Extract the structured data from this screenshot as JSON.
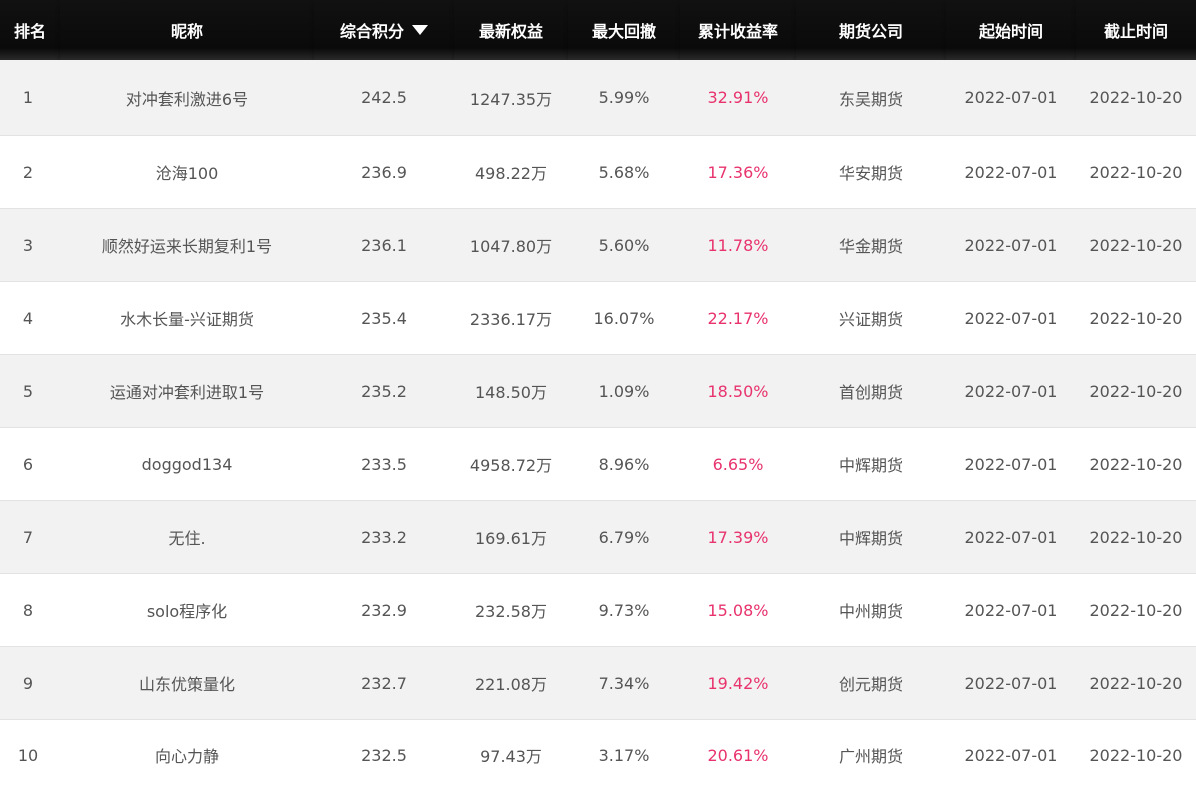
{
  "columns": {
    "rank": "排名",
    "nickname": "昵称",
    "score": "综合积分",
    "equity": "最新权益",
    "drawdown": "最大回撤",
    "return": "累计收益率",
    "broker": "期货公司",
    "start": "起始时间",
    "end": "截止时间"
  },
  "icons": {
    "sort": "sort-descending-triangle"
  },
  "colors": {
    "header_bg": "#111111",
    "row_alt": "#f2f2f2",
    "return_text": "#e8336d"
  },
  "rows": [
    {
      "rank": "1",
      "nickname": "对冲套利激进6号",
      "score": "242.5",
      "equity": "1247.35万",
      "drawdown": "5.99%",
      "return": "32.91%",
      "broker": "东吴期货",
      "start": "2022-07-01",
      "end": "2022-10-20"
    },
    {
      "rank": "2",
      "nickname": "沧海100",
      "score": "236.9",
      "equity": "498.22万",
      "drawdown": "5.68%",
      "return": "17.36%",
      "broker": "华安期货",
      "start": "2022-07-01",
      "end": "2022-10-20"
    },
    {
      "rank": "3",
      "nickname": "顺然好运来长期复利1号",
      "score": "236.1",
      "equity": "1047.80万",
      "drawdown": "5.60%",
      "return": "11.78%",
      "broker": "华金期货",
      "start": "2022-07-01",
      "end": "2022-10-20"
    },
    {
      "rank": "4",
      "nickname": "水木长量-兴证期货",
      "score": "235.4",
      "equity": "2336.17万",
      "drawdown": "16.07%",
      "return": "22.17%",
      "broker": "兴证期货",
      "start": "2022-07-01",
      "end": "2022-10-20"
    },
    {
      "rank": "5",
      "nickname": "运通对冲套利进取1号",
      "score": "235.2",
      "equity": "148.50万",
      "drawdown": "1.09%",
      "return": "18.50%",
      "broker": "首创期货",
      "start": "2022-07-01",
      "end": "2022-10-20"
    },
    {
      "rank": "6",
      "nickname": "doggod134",
      "score": "233.5",
      "equity": "4958.72万",
      "drawdown": "8.96%",
      "return": "6.65%",
      "broker": "中辉期货",
      "start": "2022-07-01",
      "end": "2022-10-20"
    },
    {
      "rank": "7",
      "nickname": "无住.",
      "score": "233.2",
      "equity": "169.61万",
      "drawdown": "6.79%",
      "return": "17.39%",
      "broker": "中辉期货",
      "start": "2022-07-01",
      "end": "2022-10-20"
    },
    {
      "rank": "8",
      "nickname": "solo程序化",
      "score": "232.9",
      "equity": "232.58万",
      "drawdown": "9.73%",
      "return": "15.08%",
      "broker": "中州期货",
      "start": "2022-07-01",
      "end": "2022-10-20"
    },
    {
      "rank": "9",
      "nickname": "山东优策量化",
      "score": "232.7",
      "equity": "221.08万",
      "drawdown": "7.34%",
      "return": "19.42%",
      "broker": "创元期货",
      "start": "2022-07-01",
      "end": "2022-10-20"
    },
    {
      "rank": "10",
      "nickname": "向心力静",
      "score": "232.5",
      "equity": "97.43万",
      "drawdown": "3.17%",
      "return": "20.61%",
      "broker": "广州期货",
      "start": "2022-07-01",
      "end": "2022-10-20"
    }
  ]
}
